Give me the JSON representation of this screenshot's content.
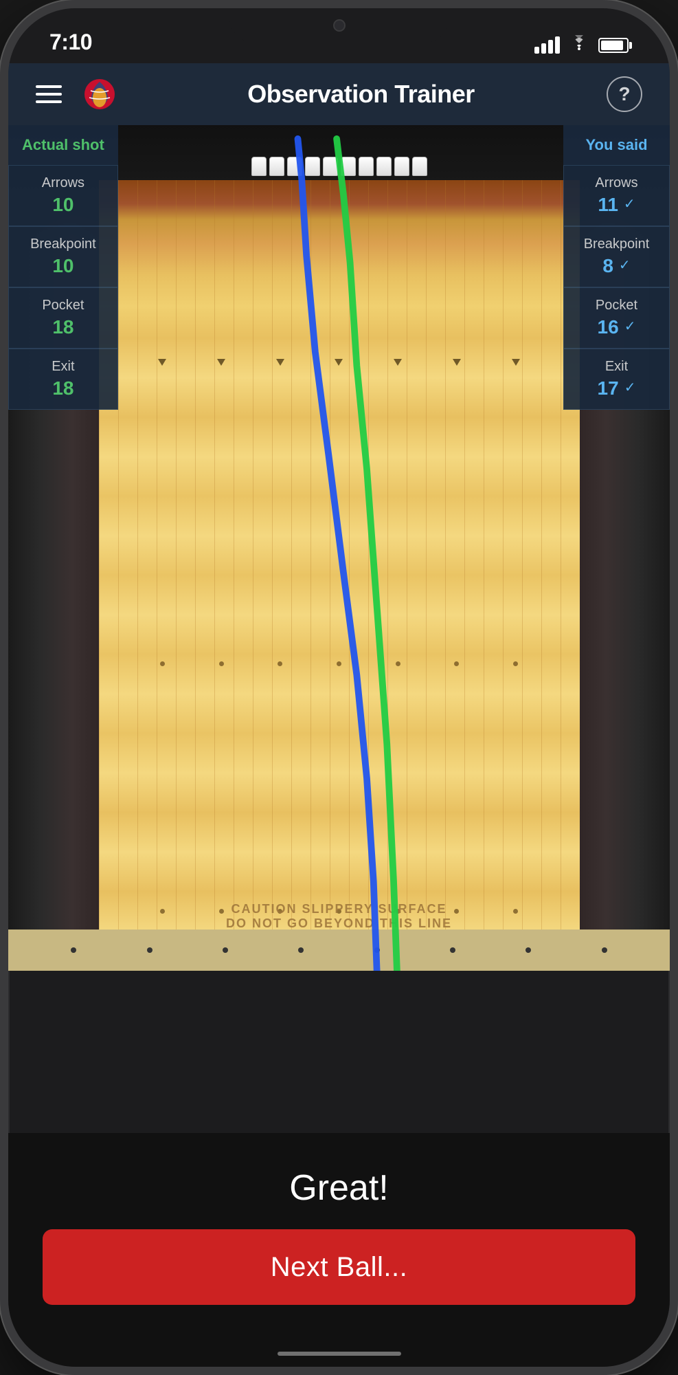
{
  "status": {
    "time": "7:10",
    "signal_bars": 4,
    "wifi": true,
    "battery": 90
  },
  "nav": {
    "title": "Observation Trainer",
    "help_label": "?"
  },
  "actual_shot": {
    "header": "Actual shot",
    "arrows_label": "Arrows",
    "arrows_value": "10",
    "breakpoint_label": "Breakpoint",
    "breakpoint_value": "10",
    "pocket_label": "Pocket",
    "pocket_value": "18",
    "exit_label": "Exit",
    "exit_value": "18"
  },
  "you_said": {
    "header": "You said",
    "arrows_label": "Arrows",
    "arrows_value": "11",
    "breakpoint_label": "Breakpoint",
    "breakpoint_value": "8",
    "pocket_label": "Pocket",
    "pocket_value": "16",
    "exit_label": "Exit",
    "exit_value": "17"
  },
  "result": {
    "message": "Great!"
  },
  "button": {
    "next_ball": "Next Ball..."
  }
}
